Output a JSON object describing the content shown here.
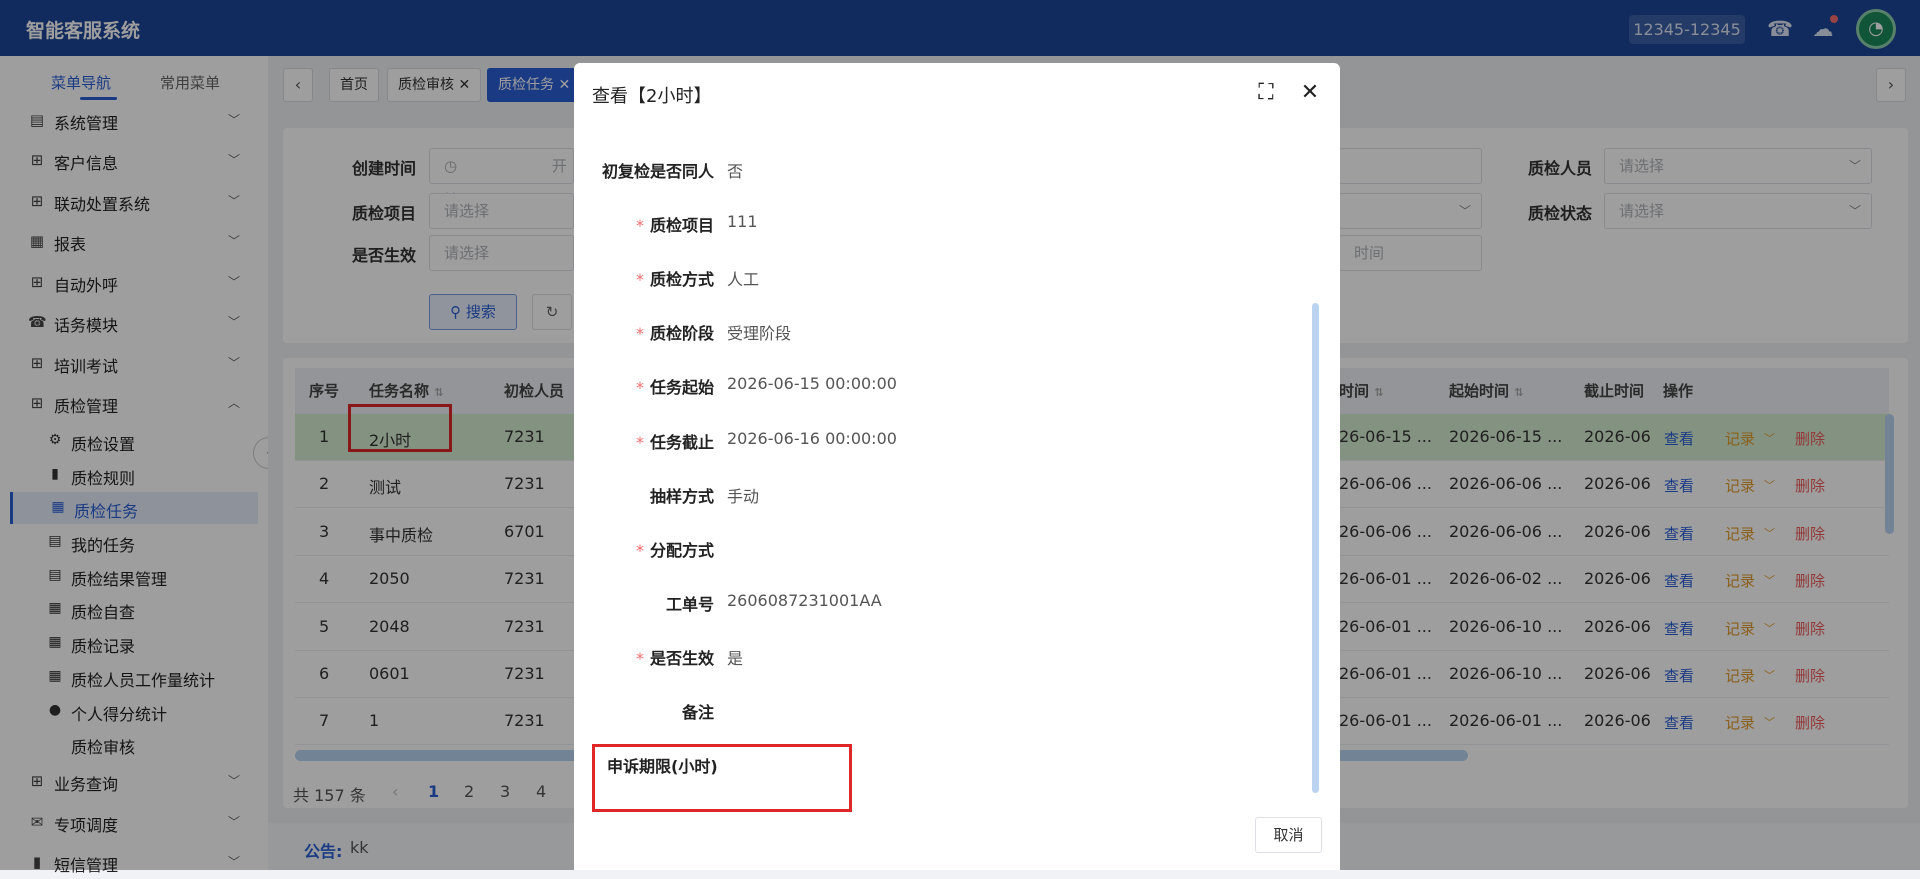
{
  "header": {
    "title": "智能客服系统",
    "phone": "12345-12345"
  },
  "sidebar": {
    "tabs": [
      "菜单导航",
      "常用菜单"
    ],
    "menus": [
      {
        "label": "系统管理",
        "icon": "document-icon"
      },
      {
        "label": "客户信息",
        "icon": "grid-icon"
      },
      {
        "label": "联动处置系统",
        "icon": "grid-icon"
      },
      {
        "label": "报表",
        "icon": "table-icon"
      },
      {
        "label": "自动外呼",
        "icon": "grid-icon"
      },
      {
        "label": "话务模块",
        "icon": "phone-icon"
      },
      {
        "label": "培训考试",
        "icon": "grid-icon"
      },
      {
        "label": "质检管理",
        "icon": "grid-icon"
      }
    ],
    "submenus": [
      {
        "label": "质检设置",
        "icon": "gear-icon"
      },
      {
        "label": "质检规则",
        "icon": "bar-chart-icon"
      },
      {
        "label": "质检任务",
        "icon": "table-icon"
      },
      {
        "label": "我的任务",
        "icon": "document-icon"
      },
      {
        "label": "质检结果管理",
        "icon": "document-icon"
      },
      {
        "label": "质检自查",
        "icon": "table-icon"
      },
      {
        "label": "质检记录",
        "icon": "table-icon"
      },
      {
        "label": "质检人员工作量统计",
        "icon": "table-icon"
      },
      {
        "label": "个人得分统计",
        "icon": "user-icon"
      },
      {
        "label": "质检审核",
        "icon": ""
      }
    ],
    "menus_after": [
      {
        "label": "业务查询",
        "icon": "grid-icon"
      },
      {
        "label": "专项调度",
        "icon": "mail-icon"
      },
      {
        "label": "短信管理",
        "icon": "bar-chart-icon"
      }
    ]
  },
  "tabs": {
    "items": [
      "首页",
      "质检审核",
      "质检任务"
    ]
  },
  "filter": {
    "create_time_label": "创建时间",
    "start_placeholder": "开始",
    "project_label": "质检项目",
    "effective_label": "是否生效",
    "select_placeholder": "请选择",
    "inspector_label": "质检人员",
    "status_label": "质检状态",
    "time_placeholder_partial": "时间",
    "search_button": "搜索",
    "reset_icon": "↻"
  },
  "table": {
    "headers": {
      "index": "序号",
      "name": "任务名称",
      "initial": "初检人员",
      "end_partial": "时间",
      "start_time": "起始时间",
      "cutoff_time": "截止时间",
      "ops": "操作"
    },
    "rows": [
      {
        "index": "1",
        "name": "2小时",
        "initial": "7231",
        "end": "26-06-15 ...",
        "start": "2026-06-15 ...",
        "cutoff": "2026-06"
      },
      {
        "index": "2",
        "name": "测试",
        "initial": "7231",
        "end": "26-06-06 ...",
        "start": "2026-06-06 ...",
        "cutoff": "2026-06"
      },
      {
        "index": "3",
        "name": "事中质检",
        "initial": "6701",
        "end": "26-06-06 ...",
        "start": "2026-06-06 ...",
        "cutoff": "2026-06"
      },
      {
        "index": "4",
        "name": "2050",
        "initial": "7231",
        "end": "26-06-01 ...",
        "start": "2026-06-02 ...",
        "cutoff": "2026-06"
      },
      {
        "index": "5",
        "name": "2048",
        "initial": "7231",
        "end": "26-06-01 ...",
        "start": "2026-06-10 ...",
        "cutoff": "2026-06"
      },
      {
        "index": "6",
        "name": "0601",
        "initial": "7231",
        "end": "26-06-01 ...",
        "start": "2026-06-10 ...",
        "cutoff": "2026-06"
      },
      {
        "index": "7",
        "name": "1",
        "initial": "7231",
        "end": "26-06-01 ...",
        "start": "2026-06-01 ...",
        "cutoff": "2026-06"
      }
    ],
    "actions": {
      "view": "查看",
      "record": "记录",
      "delete": "删除"
    }
  },
  "pagination": {
    "total": "共 157 条",
    "pages": [
      "1",
      "2",
      "3",
      "4"
    ]
  },
  "notice": {
    "label": "公告:",
    "text": "kk"
  },
  "dialog": {
    "title": "查看【2小时】",
    "fields": [
      {
        "label": "初复检是否同人",
        "value": "否",
        "required": false
      },
      {
        "label": "质检项目",
        "value": "111",
        "required": true
      },
      {
        "label": "质检方式",
        "value": "人工",
        "required": true
      },
      {
        "label": "质检阶段",
        "value": "受理阶段",
        "required": true
      },
      {
        "label": "任务起始",
        "value": "2026-06-15 00:00:00",
        "required": true
      },
      {
        "label": "任务截止",
        "value": "2026-06-16 00:00:00",
        "required": true
      },
      {
        "label": "抽样方式",
        "value": "手动",
        "required": false
      },
      {
        "label": "分配方式",
        "value": "",
        "required": true
      },
      {
        "label": "工单号",
        "value": "2606087231001AA",
        "required": false
      },
      {
        "label": "是否生效",
        "value": "是",
        "required": true
      },
      {
        "label": "备注",
        "value": "",
        "required": false
      }
    ],
    "appeal_label": "申诉期限(小时)",
    "cancel": "取消"
  },
  "colors": {
    "brand": "#1d4698",
    "accent": "#2b5fd6",
    "highlight_row": "#d5ecd0",
    "annotation_red": "#e02727"
  }
}
